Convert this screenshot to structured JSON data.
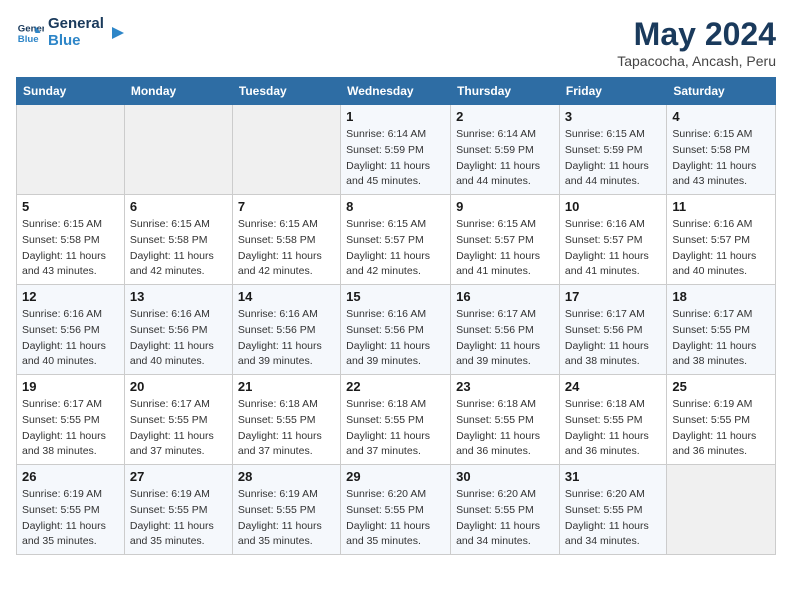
{
  "logo": {
    "line1": "General",
    "line2": "Blue"
  },
  "title": "May 2024",
  "subtitle": "Tapacocha, Ancash, Peru",
  "headers": [
    "Sunday",
    "Monday",
    "Tuesday",
    "Wednesday",
    "Thursday",
    "Friday",
    "Saturday"
  ],
  "weeks": [
    [
      {
        "day": "",
        "detail": ""
      },
      {
        "day": "",
        "detail": ""
      },
      {
        "day": "",
        "detail": ""
      },
      {
        "day": "1",
        "detail": "Sunrise: 6:14 AM\nSunset: 5:59 PM\nDaylight: 11 hours and 45 minutes."
      },
      {
        "day": "2",
        "detail": "Sunrise: 6:14 AM\nSunset: 5:59 PM\nDaylight: 11 hours and 44 minutes."
      },
      {
        "day": "3",
        "detail": "Sunrise: 6:15 AM\nSunset: 5:59 PM\nDaylight: 11 hours and 44 minutes."
      },
      {
        "day": "4",
        "detail": "Sunrise: 6:15 AM\nSunset: 5:58 PM\nDaylight: 11 hours and 43 minutes."
      }
    ],
    [
      {
        "day": "5",
        "detail": "Sunrise: 6:15 AM\nSunset: 5:58 PM\nDaylight: 11 hours and 43 minutes."
      },
      {
        "day": "6",
        "detail": "Sunrise: 6:15 AM\nSunset: 5:58 PM\nDaylight: 11 hours and 42 minutes."
      },
      {
        "day": "7",
        "detail": "Sunrise: 6:15 AM\nSunset: 5:58 PM\nDaylight: 11 hours and 42 minutes."
      },
      {
        "day": "8",
        "detail": "Sunrise: 6:15 AM\nSunset: 5:57 PM\nDaylight: 11 hours and 42 minutes."
      },
      {
        "day": "9",
        "detail": "Sunrise: 6:15 AM\nSunset: 5:57 PM\nDaylight: 11 hours and 41 minutes."
      },
      {
        "day": "10",
        "detail": "Sunrise: 6:16 AM\nSunset: 5:57 PM\nDaylight: 11 hours and 41 minutes."
      },
      {
        "day": "11",
        "detail": "Sunrise: 6:16 AM\nSunset: 5:57 PM\nDaylight: 11 hours and 40 minutes."
      }
    ],
    [
      {
        "day": "12",
        "detail": "Sunrise: 6:16 AM\nSunset: 5:56 PM\nDaylight: 11 hours and 40 minutes."
      },
      {
        "day": "13",
        "detail": "Sunrise: 6:16 AM\nSunset: 5:56 PM\nDaylight: 11 hours and 40 minutes."
      },
      {
        "day": "14",
        "detail": "Sunrise: 6:16 AM\nSunset: 5:56 PM\nDaylight: 11 hours and 39 minutes."
      },
      {
        "day": "15",
        "detail": "Sunrise: 6:16 AM\nSunset: 5:56 PM\nDaylight: 11 hours and 39 minutes."
      },
      {
        "day": "16",
        "detail": "Sunrise: 6:17 AM\nSunset: 5:56 PM\nDaylight: 11 hours and 39 minutes."
      },
      {
        "day": "17",
        "detail": "Sunrise: 6:17 AM\nSunset: 5:56 PM\nDaylight: 11 hours and 38 minutes."
      },
      {
        "day": "18",
        "detail": "Sunrise: 6:17 AM\nSunset: 5:55 PM\nDaylight: 11 hours and 38 minutes."
      }
    ],
    [
      {
        "day": "19",
        "detail": "Sunrise: 6:17 AM\nSunset: 5:55 PM\nDaylight: 11 hours and 38 minutes."
      },
      {
        "day": "20",
        "detail": "Sunrise: 6:17 AM\nSunset: 5:55 PM\nDaylight: 11 hours and 37 minutes."
      },
      {
        "day": "21",
        "detail": "Sunrise: 6:18 AM\nSunset: 5:55 PM\nDaylight: 11 hours and 37 minutes."
      },
      {
        "day": "22",
        "detail": "Sunrise: 6:18 AM\nSunset: 5:55 PM\nDaylight: 11 hours and 37 minutes."
      },
      {
        "day": "23",
        "detail": "Sunrise: 6:18 AM\nSunset: 5:55 PM\nDaylight: 11 hours and 36 minutes."
      },
      {
        "day": "24",
        "detail": "Sunrise: 6:18 AM\nSunset: 5:55 PM\nDaylight: 11 hours and 36 minutes."
      },
      {
        "day": "25",
        "detail": "Sunrise: 6:19 AM\nSunset: 5:55 PM\nDaylight: 11 hours and 36 minutes."
      }
    ],
    [
      {
        "day": "26",
        "detail": "Sunrise: 6:19 AM\nSunset: 5:55 PM\nDaylight: 11 hours and 35 minutes."
      },
      {
        "day": "27",
        "detail": "Sunrise: 6:19 AM\nSunset: 5:55 PM\nDaylight: 11 hours and 35 minutes."
      },
      {
        "day": "28",
        "detail": "Sunrise: 6:19 AM\nSunset: 5:55 PM\nDaylight: 11 hours and 35 minutes."
      },
      {
        "day": "29",
        "detail": "Sunrise: 6:20 AM\nSunset: 5:55 PM\nDaylight: 11 hours and 35 minutes."
      },
      {
        "day": "30",
        "detail": "Sunrise: 6:20 AM\nSunset: 5:55 PM\nDaylight: 11 hours and 34 minutes."
      },
      {
        "day": "31",
        "detail": "Sunrise: 6:20 AM\nSunset: 5:55 PM\nDaylight: 11 hours and 34 minutes."
      },
      {
        "day": "",
        "detail": ""
      }
    ]
  ]
}
